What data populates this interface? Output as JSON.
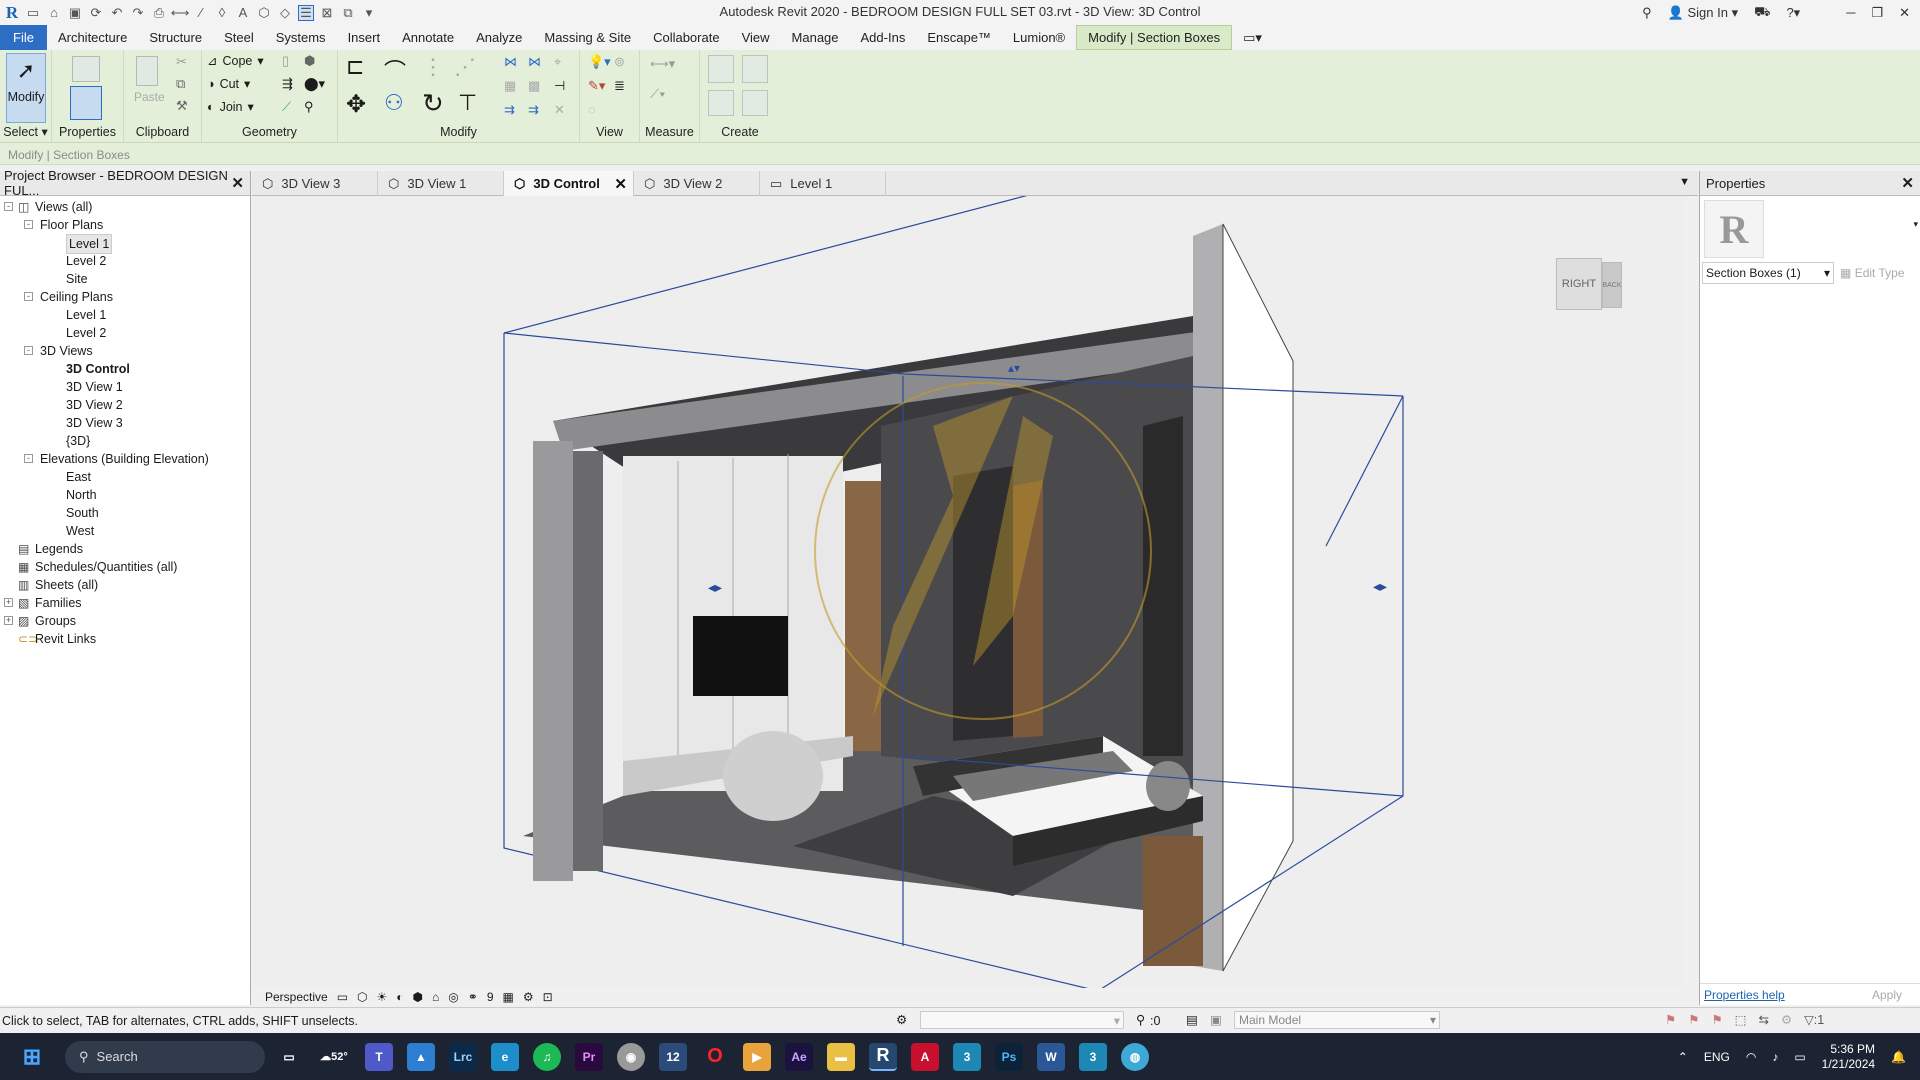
{
  "titlebar": {
    "title": "Autodesk Revit 2020 - BEDROOM DESIGN FULL SET 03.rvt - 3D View: 3D Control",
    "sign_in": "Sign In"
  },
  "menu": {
    "file": "File",
    "tabs": [
      "Architecture",
      "Structure",
      "Steel",
      "Systems",
      "Insert",
      "Annotate",
      "Analyze",
      "Massing & Site",
      "Collaborate",
      "View",
      "Manage",
      "Add-Ins",
      "Enscape™",
      "Lumion®"
    ],
    "context_tab": "Modify | Section Boxes"
  },
  "ribbon": {
    "modify_label": "Modify",
    "select_label": "Select",
    "properties_label": "Properties",
    "paste_label": "Paste",
    "clipboard_label": "Clipboard",
    "cope_label": "Cope",
    "cut_label": "Cut",
    "join_label": "Join",
    "geometry_label": "Geometry",
    "modify_panel_label": "Modify",
    "view_label": "View",
    "measure_label": "Measure",
    "create_label": "Create"
  },
  "context_bar": "Modify | Section Boxes",
  "doc_tabs": [
    "3D View 3",
    "3D View 1",
    "3D Control",
    "3D View 2",
    "Level 1"
  ],
  "project_browser": {
    "title": "Project Browser - BEDROOM DESIGN FUL...",
    "nodes": [
      {
        "label": "Views (all)",
        "level": 0,
        "toggle": "-",
        "icon": "views"
      },
      {
        "label": "Floor Plans",
        "level": 1,
        "toggle": "-"
      },
      {
        "label": "Level 1",
        "level": 2,
        "selected": true
      },
      {
        "label": "Level 2",
        "level": 2
      },
      {
        "label": "Site",
        "level": 2
      },
      {
        "label": "Ceiling Plans",
        "level": 1,
        "toggle": "-"
      },
      {
        "label": "Level 1",
        "level": 2
      },
      {
        "label": "Level 2",
        "level": 2
      },
      {
        "label": "3D Views",
        "level": 1,
        "toggle": "-"
      },
      {
        "label": "3D Control",
        "level": 2,
        "bold": true
      },
      {
        "label": "3D View 1",
        "level": 2
      },
      {
        "label": "3D View 2",
        "level": 2
      },
      {
        "label": "3D View 3",
        "level": 2
      },
      {
        "label": "{3D}",
        "level": 2
      },
      {
        "label": "Elevations (Building Elevation)",
        "level": 1,
        "toggle": "-"
      },
      {
        "label": "East",
        "level": 2
      },
      {
        "label": "North",
        "level": 2
      },
      {
        "label": "South",
        "level": 2
      },
      {
        "label": "West",
        "level": 2
      },
      {
        "label": "Legends",
        "level": 0,
        "icon": "legend"
      },
      {
        "label": "Schedules/Quantities (all)",
        "level": 0,
        "icon": "schedule"
      },
      {
        "label": "Sheets (all)",
        "level": 0,
        "icon": "sheet"
      },
      {
        "label": "Families",
        "level": 0,
        "toggle": "+",
        "icon": "family"
      },
      {
        "label": "Groups",
        "level": 0,
        "toggle": "+",
        "icon": "group"
      },
      {
        "label": "Revit Links",
        "level": 0,
        "icon": "link"
      }
    ]
  },
  "viewcube": {
    "front": "RIGHT",
    "side": "BACK"
  },
  "properties": {
    "title": "Properties",
    "type_selector": "Section Boxes (1)",
    "edit_type": "Edit Type",
    "help": "Properties help",
    "apply": "Apply"
  },
  "view_control": {
    "scale": "Perspective",
    "hidden_count": "9"
  },
  "status": {
    "hint": "Click to select, TAB for alternates, CTRL adds, SHIFT unselects.",
    "count": ":0",
    "model": "Main Model",
    "filter": ":1"
  },
  "taskbar": {
    "search": "Search",
    "temp": "52°",
    "lang": "ENG",
    "time": "5:36 PM",
    "date": "1/21/2024"
  }
}
